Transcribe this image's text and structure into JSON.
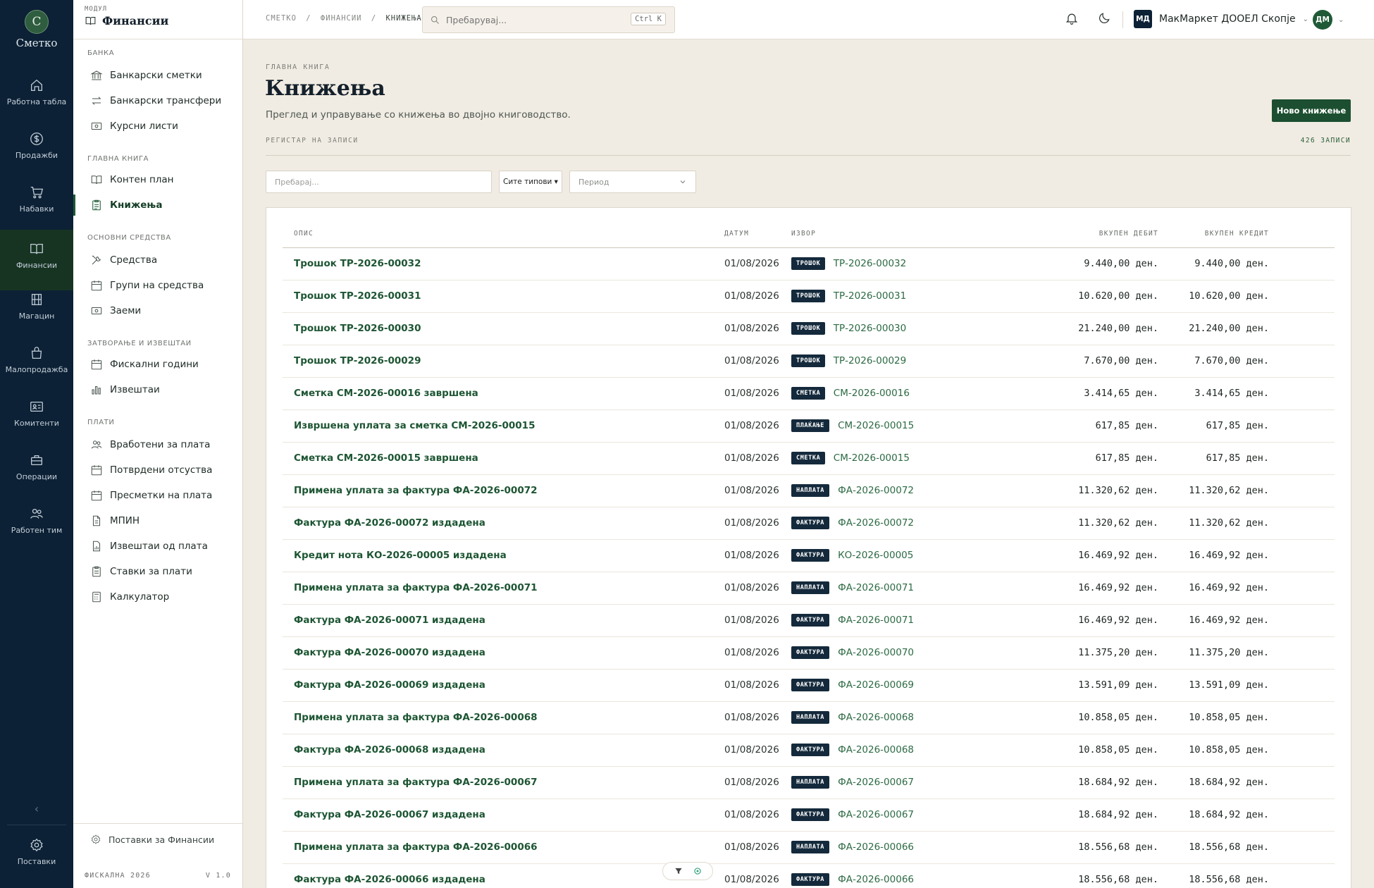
{
  "app": {
    "logo_letter": "С",
    "logo_text": "Сметко"
  },
  "rail": [
    {
      "label": "Работна табла",
      "icon": "home-icon"
    },
    {
      "label": "Продажби",
      "icon": "dollar-icon"
    },
    {
      "label": "Набавки",
      "icon": "cart-icon"
    },
    {
      "label": "Финансии",
      "icon": "book-icon",
      "active": true
    },
    {
      "label": "Магацин",
      "icon": "warehouse-icon"
    },
    {
      "label": "Малопродажба",
      "icon": "bag-icon"
    },
    {
      "label": "Комитенти",
      "icon": "contact-card-icon"
    },
    {
      "label": "Операции",
      "icon": "briefcase-icon"
    },
    {
      "label": "Работен тим",
      "icon": "team-icon"
    }
  ],
  "rail_settings": "Поставки",
  "panel": {
    "kicker": "МОДУЛ",
    "title": "Финансии",
    "sections": {
      "bank": "БАНКА",
      "ledger": "ГЛАВНА КНИГА",
      "assets": "ОСНОВНИ СРЕДСТВА",
      "closing": "ЗАТВОРАЊЕ И ИЗВЕШТАИ",
      "payroll": "ПЛАТИ"
    },
    "items": {
      "bank_accounts": "Банкарски сметки",
      "bank_transfers": "Банкарски трансфери",
      "exchange_rates": "Курсни листи",
      "chart_of_accounts": "Контен план",
      "postings": "Книжења",
      "assets": "Средства",
      "asset_groups": "Групи на средства",
      "loans": "Заеми",
      "fiscal_years": "Фискални години",
      "reports": "Извештаи",
      "payroll_employees": "Вработени за плата",
      "approved_absences": "Потврдени отсуства",
      "payroll_calcs": "Пресметки на плата",
      "mpin": "МПИН",
      "payroll_reports": "Извештаи од плата",
      "payroll_items": "Ставки за плати",
      "calculator": "Калкулатор"
    },
    "footer_settings": "Поставки за Финансии",
    "fiscal_label": "ФИСКАЛНА 2026",
    "version": "V 1.0"
  },
  "topbar": {
    "crumb1": "СМЕТКО",
    "crumb2": "ФИНАНСИИ",
    "crumb3": "КНИЖЕЊА",
    "sep": "/",
    "search_placeholder": "Пребарувај...",
    "shortcut": "Ctrl K",
    "org_initials": "МД",
    "org_name": "МакМаркет ДООЕЛ Скопје",
    "user_initials": "ДМ"
  },
  "page": {
    "kicker": "ГЛАВНА КНИГА",
    "title": "Книжења",
    "subtitle": "Преглед и управување со книжења во двојно книговодство.",
    "new_button": "Ново книжење",
    "register_label": "РЕГИСТАР НА ЗАПИСИ",
    "record_count": "426 ЗАПИСИ"
  },
  "filters": {
    "search_placeholder": "Пребарај...",
    "types": "Сите типови ▾",
    "period_placeholder": "Период"
  },
  "table": {
    "headers": {
      "desc": "ОПИС",
      "date": "ДАТУМ",
      "source": "ИЗВОР",
      "debit": "ВКУПЕН ДЕБИТ",
      "credit": "ВКУПЕН КРЕДИТ"
    },
    "rows": [
      {
        "desc": "Трошок ТР-2026-00032",
        "date": "01/08/2026",
        "badge": "ТРОШОК",
        "ref": "ТР-2026-00032",
        "debit": "9.440,00 ден.",
        "credit": "9.440,00 ден."
      },
      {
        "desc": "Трошок ТР-2026-00031",
        "date": "01/08/2026",
        "badge": "ТРОШОК",
        "ref": "ТР-2026-00031",
        "debit": "10.620,00 ден.",
        "credit": "10.620,00 ден."
      },
      {
        "desc": "Трошок ТР-2026-00030",
        "date": "01/08/2026",
        "badge": "ТРОШОК",
        "ref": "ТР-2026-00030",
        "debit": "21.240,00 ден.",
        "credit": "21.240,00 ден."
      },
      {
        "desc": "Трошок ТР-2026-00029",
        "date": "01/08/2026",
        "badge": "ТРОШОК",
        "ref": "ТР-2026-00029",
        "debit": "7.670,00 ден.",
        "credit": "7.670,00 ден."
      },
      {
        "desc": "Сметка СМ-2026-00016 завршена",
        "date": "01/08/2026",
        "badge": "СМЕТКА",
        "ref": "СМ-2026-00016",
        "debit": "3.414,65 ден.",
        "credit": "3.414,65 ден."
      },
      {
        "desc": "Извршена уплата за сметка СМ-2026-00015",
        "date": "01/08/2026",
        "badge": "ПЛАЌАЊЕ",
        "ref": "СМ-2026-00015",
        "debit": "617,85 ден.",
        "credit": "617,85 ден."
      },
      {
        "desc": "Сметка СМ-2026-00015 завршена",
        "date": "01/08/2026",
        "badge": "СМЕТКА",
        "ref": "СМ-2026-00015",
        "debit": "617,85 ден.",
        "credit": "617,85 ден."
      },
      {
        "desc": "Примена уплата за фактура ФА-2026-00072",
        "date": "01/08/2026",
        "badge": "НАПЛАТА",
        "ref": "ФА-2026-00072",
        "debit": "11.320,62 ден.",
        "credit": "11.320,62 ден."
      },
      {
        "desc": "Фактура ФА-2026-00072 издадена",
        "date": "01/08/2026",
        "badge": "ФАКТУРА",
        "ref": "ФА-2026-00072",
        "debit": "11.320,62 ден.",
        "credit": "11.320,62 ден."
      },
      {
        "desc": "Кредит нота КО-2026-00005 издадена",
        "date": "01/08/2026",
        "badge": "ФАКТУРА",
        "ref": "КО-2026-00005",
        "debit": "16.469,92 ден.",
        "credit": "16.469,92 ден."
      },
      {
        "desc": "Примена уплата за фактура ФА-2026-00071",
        "date": "01/08/2026",
        "badge": "НАПЛАТА",
        "ref": "ФА-2026-00071",
        "debit": "16.469,92 ден.",
        "credit": "16.469,92 ден."
      },
      {
        "desc": "Фактура ФА-2026-00071 издадена",
        "date": "01/08/2026",
        "badge": "ФАКТУРА",
        "ref": "ФА-2026-00071",
        "debit": "16.469,92 ден.",
        "credit": "16.469,92 ден."
      },
      {
        "desc": "Фактура ФА-2026-00070 издадена",
        "date": "01/08/2026",
        "badge": "ФАКТУРА",
        "ref": "ФА-2026-00070",
        "debit": "11.375,20 ден.",
        "credit": "11.375,20 ден."
      },
      {
        "desc": "Фактура ФА-2026-00069 издадена",
        "date": "01/08/2026",
        "badge": "ФАКТУРА",
        "ref": "ФА-2026-00069",
        "debit": "13.591,09 ден.",
        "credit": "13.591,09 ден."
      },
      {
        "desc": "Примена уплата за фактура ФА-2026-00068",
        "date": "01/08/2026",
        "badge": "НАПЛАТА",
        "ref": "ФА-2026-00068",
        "debit": "10.858,05 ден.",
        "credit": "10.858,05 ден."
      },
      {
        "desc": "Фактура ФА-2026-00068 издадена",
        "date": "01/08/2026",
        "badge": "ФАКТУРА",
        "ref": "ФА-2026-00068",
        "debit": "10.858,05 ден.",
        "credit": "10.858,05 ден."
      },
      {
        "desc": "Примена уплата за фактура ФА-2026-00067",
        "date": "01/08/2026",
        "badge": "НАПЛАТА",
        "ref": "ФА-2026-00067",
        "debit": "18.684,92 ден.",
        "credit": "18.684,92 ден."
      },
      {
        "desc": "Фактура ФА-2026-00067 издадена",
        "date": "01/08/2026",
        "badge": "ФАКТУРА",
        "ref": "ФА-2026-00067",
        "debit": "18.684,92 ден.",
        "credit": "18.684,92 ден."
      },
      {
        "desc": "Примена уплата за фактура ФА-2026-00066",
        "date": "01/08/2026",
        "badge": "НАПЛАТА",
        "ref": "ФА-2026-00066",
        "debit": "18.556,68 ден.",
        "credit": "18.556,68 ден."
      },
      {
        "desc": "Фактура ФА-2026-00066 издадена",
        "date": "01/08/2026",
        "badge": "ФАКТУРА",
        "ref": "ФА-2026-00066",
        "debit": "18.556,68 ден.",
        "credit": "18.556,68 ден."
      }
    ]
  },
  "colors": {
    "rail_bg": "#0c2135",
    "accent_green": "#1c4f31",
    "badge_bg": "#142a3c",
    "page_bg": "#f1ece3"
  }
}
